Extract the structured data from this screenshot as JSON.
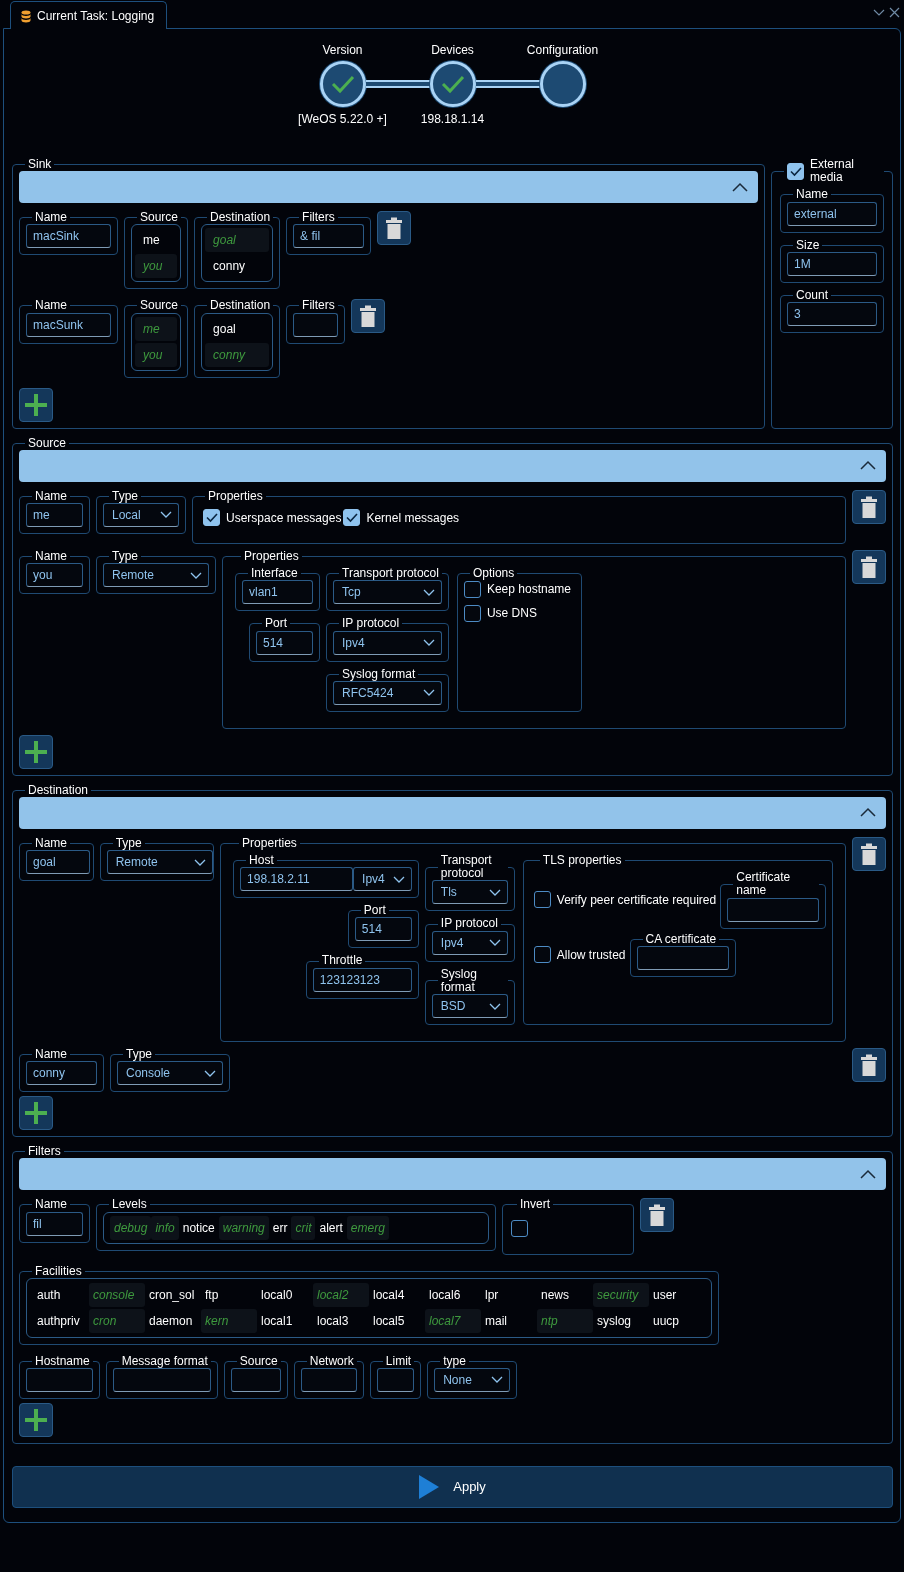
{
  "tab": {
    "title": "Current Task: Logging"
  },
  "stepper": [
    {
      "label": "Version",
      "caption": "[WeOS 5.22.0 +]",
      "done": true
    },
    {
      "label": "Devices",
      "caption": "198.18.1.14",
      "done": true
    },
    {
      "label": "Configuration",
      "done": false
    }
  ],
  "sink": {
    "title": "Sink",
    "expanded": true,
    "rows": [
      {
        "lines": [
          [
            {
              "kind": "text",
              "label": "Name",
              "value": "macSink"
            },
            {
              "kind": "list",
              "label": "Source",
              "items": [
                {
                  "text": "me",
                  "selected": false
                },
                {
                  "text": "you",
                  "selected": true
                }
              ]
            },
            {
              "kind": "list",
              "label": "Destination",
              "items": [
                {
                  "text": "goal",
                  "selected": true
                },
                {
                  "text": "conny",
                  "selected": false
                }
              ]
            },
            {
              "kind": "text",
              "label": "Filters",
              "value": "& fil"
            }
          ]
        ]
      },
      {
        "lines": [
          [
            {
              "kind": "text",
              "label": "Name",
              "value": "macSunk"
            },
            {
              "kind": "list",
              "label": "Source",
              "items": [
                {
                  "text": "me",
                  "selected": true
                },
                {
                  "text": "you",
                  "selected": true
                }
              ]
            },
            {
              "kind": "list",
              "label": "Destination",
              "items": [
                {
                  "text": "goal",
                  "selected": false
                },
                {
                  "text": "conny",
                  "selected": true
                }
              ]
            },
            {
              "kind": "text",
              "label": "Filters"
            }
          ]
        ]
      }
    ]
  },
  "external_media": {
    "label": "External media",
    "checked": true,
    "fields": [
      {
        "kind": "text",
        "label": "Name",
        "value": "external"
      },
      {
        "kind": "text",
        "label": "Size",
        "value": "1M"
      },
      {
        "kind": "text",
        "label": "Count",
        "value": "3"
      }
    ]
  },
  "source": {
    "title": "Source",
    "expanded": true,
    "rows": [
      {
        "lines": [
          [
            {
              "kind": "text",
              "label": "Name",
              "value": "me"
            },
            {
              "kind": "select",
              "label": "Type",
              "value": "Local"
            },
            {
              "kind": "checks_row",
              "label": "Properties",
              "items": [
                {
                  "label": "Userspace messages",
                  "checked": true
                },
                {
                  "label": "Kernel messages",
                  "checked": true
                }
              ]
            }
          ]
        ]
      },
      {
        "lines": [
          [
            {
              "kind": "text",
              "label": "Name",
              "value": "you"
            },
            {
              "kind": "select",
              "label": "Type",
              "value": "Remote"
            },
            {
              "kind": "columns",
              "label": "Properties",
              "columns": [
                [
                  {
                    "kind": "text",
                    "label": "Interface",
                    "value": "vlan1"
                  },
                  {
                    "kind": "text",
                    "label": "Port",
                    "value": "514"
                  }
                ],
                [
                  {
                    "kind": "select",
                    "label": "Transport protocol",
                    "value": "Tcp"
                  },
                  {
                    "kind": "select",
                    "label": "IP protocol",
                    "value": "Ipv4"
                  },
                  {
                    "kind": "select",
                    "label": "Syslog format",
                    "value": "RFC5424"
                  }
                ],
                [
                  {
                    "kind": "checks",
                    "label": "Options",
                    "items": [
                      {
                        "label": "Keep hostname",
                        "checked": false
                      },
                      {
                        "label": "Use DNS",
                        "checked": false
                      }
                    ]
                  }
                ]
              ]
            }
          ]
        ]
      }
    ]
  },
  "destination": {
    "title": "Destination",
    "expanded": true,
    "rows": [
      {
        "lines": [
          [
            {
              "kind": "text",
              "label": "Name",
              "value": "goal"
            },
            {
              "kind": "select",
              "label": "Type",
              "value": "Remote"
            },
            {
              "kind": "columns",
              "label": "Properties",
              "columns": [
                [
                  {
                    "kind": "host",
                    "label": "Host",
                    "value": "198.18.2.11",
                    "protocol": "Ipv4"
                  },
                  {
                    "kind": "text",
                    "label": "Port",
                    "value": "514"
                  },
                  {
                    "kind": "text",
                    "label": "Throttle",
                    "value": "123123123"
                  }
                ],
                [
                  {
                    "kind": "select",
                    "label": "Transport protocol",
                    "value": "Tls"
                  },
                  {
                    "kind": "select",
                    "label": "IP protocol",
                    "value": "Ipv4"
                  },
                  {
                    "kind": "select",
                    "label": "Syslog format",
                    "value": "BSD"
                  }
                ],
                [
                  {
                    "kind": "tls",
                    "label": "TLS properties",
                    "rows": [
                      {
                        "check": {
                          "label": "Verify peer certificate required",
                          "checked": false
                        },
                        "field": {
                          "kind": "text",
                          "label": "Certificate name"
                        }
                      },
                      {
                        "check": {
                          "label": "Allow trusted",
                          "checked": false
                        },
                        "field": {
                          "kind": "text",
                          "label": "CA certificate"
                        }
                      }
                    ]
                  }
                ]
              ]
            }
          ]
        ]
      },
      {
        "lines": [
          [
            {
              "kind": "text",
              "label": "Name",
              "value": "conny"
            },
            {
              "kind": "select",
              "label": "Type",
              "value": "Console"
            }
          ]
        ]
      }
    ]
  },
  "filters": {
    "title": "Filters",
    "expanded": true,
    "rows": [
      {
        "lines": [
          [
            {
              "kind": "text",
              "label": "Name",
              "value": "fil"
            },
            {
              "kind": "tags",
              "label": "Levels",
              "items": [
                {
                  "text": "debug",
                  "selected": true
                },
                {
                  "text": "info",
                  "selected": true
                },
                {
                  "text": "notice",
                  "selected": false
                },
                {
                  "text": "warning",
                  "selected": true
                },
                {
                  "text": "err",
                  "selected": false
                },
                {
                  "text": "crit",
                  "selected": true
                },
                {
                  "text": "alert",
                  "selected": false
                },
                {
                  "text": "emerg",
                  "selected": true
                }
              ]
            },
            {
              "kind": "checkbox",
              "label": "Invert",
              "checked": false
            }
          ],
          [
            {
              "kind": "grid",
              "label": "Facilities",
              "items": [
                {
                  "text": "auth",
                  "selected": false
                },
                {
                  "text": "authpriv",
                  "selected": false
                },
                {
                  "text": "console",
                  "selected": true
                },
                {
                  "text": "cron",
                  "selected": true
                },
                {
                  "text": "cron_sol",
                  "selected": false
                },
                {
                  "text": "daemon",
                  "selected": false
                },
                {
                  "text": "ftp",
                  "selected": false
                },
                {
                  "text": "kern",
                  "selected": true
                },
                {
                  "text": "local0",
                  "selected": false
                },
                {
                  "text": "local1",
                  "selected": false
                },
                {
                  "text": "local2",
                  "selected": true
                },
                {
                  "text": "local3",
                  "selected": false
                },
                {
                  "text": "local4",
                  "selected": false
                },
                {
                  "text": "local5",
                  "selected": false
                },
                {
                  "text": "local6",
                  "selected": false
                },
                {
                  "text": "local7",
                  "selected": true
                },
                {
                  "text": "lpr",
                  "selected": false
                },
                {
                  "text": "mail",
                  "selected": false
                },
                {
                  "text": "news",
                  "selected": false
                },
                {
                  "text": "ntp",
                  "selected": true
                },
                {
                  "text": "security",
                  "selected": true
                },
                {
                  "text": "syslog",
                  "selected": false
                },
                {
                  "text": "user",
                  "selected": false
                },
                {
                  "text": "uucp",
                  "selected": false
                }
              ]
            }
          ],
          [
            {
              "kind": "text",
              "label": "Hostname"
            },
            {
              "kind": "text",
              "label": "Message format"
            },
            {
              "kind": "text",
              "label": "Source"
            },
            {
              "kind": "text",
              "label": "Network"
            },
            {
              "kind": "text",
              "label": "Limit"
            },
            {
              "kind": "select",
              "label": "type",
              "value": "None"
            }
          ]
        ]
      }
    ]
  },
  "apply": {
    "label": "Apply"
  }
}
